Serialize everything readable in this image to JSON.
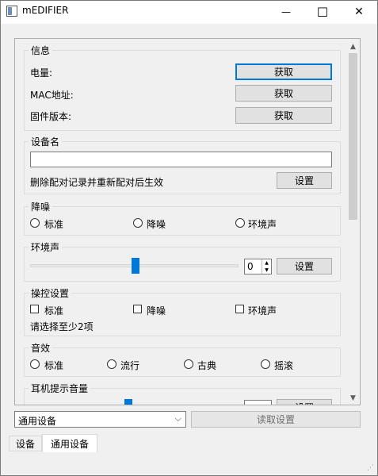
{
  "window": {
    "title": "mEDIFIER",
    "minimize_glyph": "—",
    "maximize_glyph": "☐",
    "close_glyph": "✕"
  },
  "info": {
    "title": "信息",
    "rows": [
      {
        "label": "电量:",
        "button": "获取"
      },
      {
        "label": "MAC地址:",
        "button": "获取"
      },
      {
        "label": "固件版本:",
        "button": "获取"
      }
    ]
  },
  "device_name": {
    "title": "设备名",
    "input_value": "",
    "hint": "删除配对记录并重新配对后生效",
    "button": "设置"
  },
  "noise": {
    "title": "降噪",
    "options": [
      "标准",
      "降噪",
      "环境声"
    ]
  },
  "ambient": {
    "title": "环境声",
    "level": 0,
    "spin_value": "0",
    "button": "设置"
  },
  "control": {
    "title": "操控设置",
    "options": [
      "标准",
      "降噪",
      "环境声"
    ],
    "hint": "请选择至少2项"
  },
  "sound": {
    "title": "音效",
    "options": [
      "标准",
      "流行",
      "古典",
      "摇滚"
    ]
  },
  "prompt_volume": {
    "title": "耳机提示音量",
    "button": "设置"
  },
  "bottom": {
    "combo_value": "通用设备",
    "read_button": "读取设置"
  },
  "tabs": [
    "设备",
    "通用设备"
  ]
}
